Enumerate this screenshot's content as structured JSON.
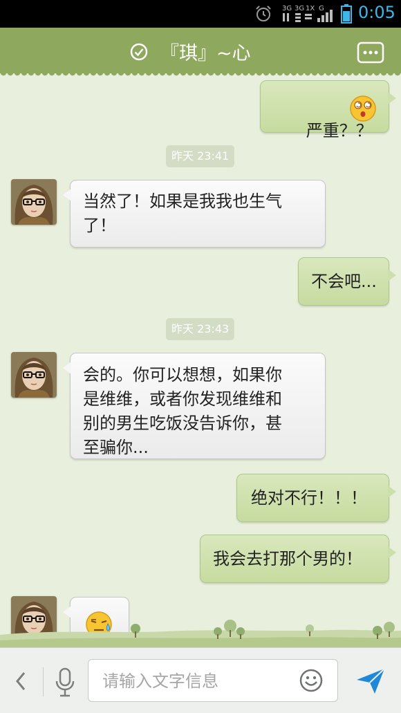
{
  "status_bar": {
    "time": "0:05",
    "network_labels": [
      "3G",
      "3G",
      "1X",
      "G"
    ]
  },
  "header": {
    "title": "『琪』~心",
    "icons": {
      "verified": "check-circle-icon",
      "menu": "more-menu-icon"
    }
  },
  "messages": [
    {
      "sender": "me",
      "text": "严重？？",
      "emoji": "dizzy-face-emoji"
    },
    {
      "type": "timestamp",
      "text": "昨天 23:41"
    },
    {
      "sender": "them",
      "text": "当然了！如果是我我也生气\n了！"
    },
    {
      "sender": "me",
      "text": "不会吧..."
    },
    {
      "type": "timestamp",
      "text": "昨天 23:43"
    },
    {
      "sender": "them",
      "text": "会的。你可以想想，如果你\n是维维，或者你发现维维和\n别的男生吃饭没告诉你，甚\n至骗你..."
    },
    {
      "sender": "me",
      "text": "绝对不行！！！"
    },
    {
      "sender": "me",
      "text": "我会去打那个男的！"
    },
    {
      "sender": "them",
      "text": "",
      "emoji": "sweat-face-emoji"
    }
  ],
  "input_bar": {
    "placeholder": "请输入文字信息",
    "value": "",
    "icons": {
      "back": "chevron-left-icon",
      "voice": "microphone-icon",
      "emoji": "smiley-icon",
      "send": "send-arrow-icon"
    }
  },
  "colors": {
    "header_bg": "#8ea95e",
    "chat_bg": "#e8efdc",
    "my_bubble": "#cde0ab",
    "their_bubble": "#f4f4f4",
    "time_accent": "#3db7ea",
    "send_accent": "#1f88d9"
  }
}
